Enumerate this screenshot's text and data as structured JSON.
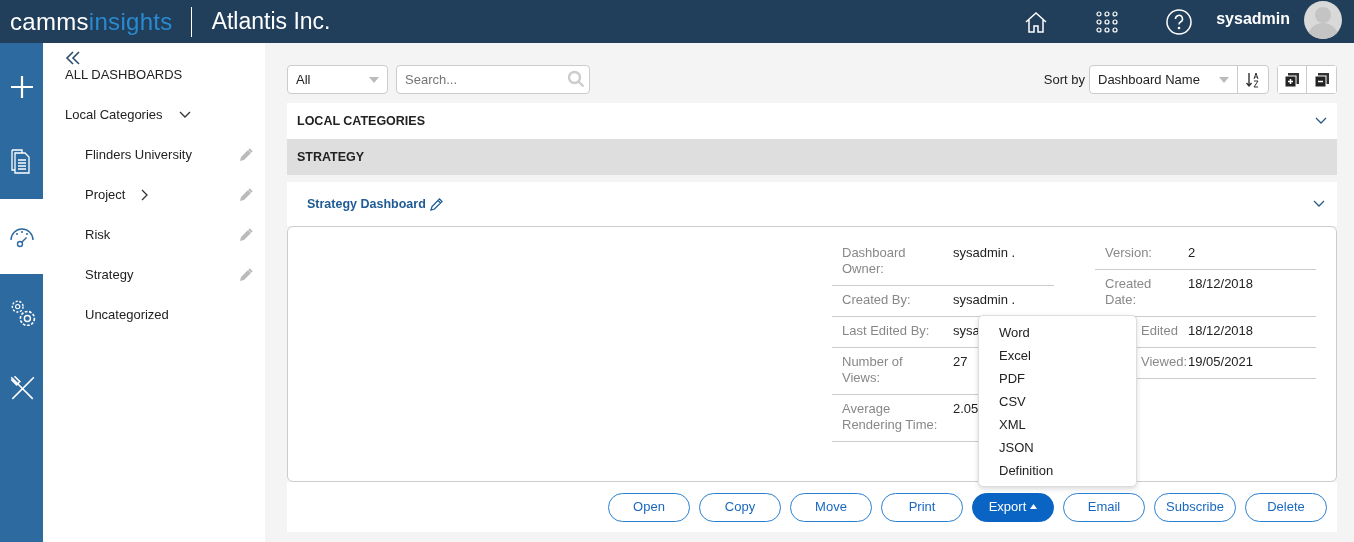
{
  "header": {
    "logo_left": "camms",
    "logo_right": "insights",
    "org": "Atlantis Inc.",
    "user": "sysadmin"
  },
  "rail": [
    {
      "selected": false
    },
    {
      "selected": false
    },
    {
      "selected": true
    },
    {
      "selected": false
    },
    {
      "selected": false
    }
  ],
  "sidebar": {
    "title": "ALL DASHBOARDS",
    "section": "Local Categories",
    "items": [
      {
        "label": "Flinders University",
        "has_children": false,
        "editable": true
      },
      {
        "label": "Project",
        "has_children": true,
        "editable": true
      },
      {
        "label": "Risk",
        "has_children": false,
        "editable": true
      },
      {
        "label": "Strategy",
        "has_children": false,
        "editable": true
      },
      {
        "label": "Uncategorized",
        "has_children": false,
        "editable": false
      }
    ]
  },
  "toolbar": {
    "filter": "All",
    "search_placeholder": "Search...",
    "sort_label": "Sort by",
    "sort_value": "Dashboard Name"
  },
  "sections": [
    {
      "title": "LOCAL CATEGORIES",
      "selected": false
    },
    {
      "title": "STRATEGY",
      "selected": true
    }
  ],
  "dashboard": {
    "name": "Strategy Dashboard",
    "details_left": [
      {
        "label": "Dashboard Owner:",
        "value": "sysadmin ."
      },
      {
        "label": "Created By:",
        "value": "sysadmin ."
      },
      {
        "label": "Last Edited By:",
        "value": "sysa"
      },
      {
        "label": "Number of Views:",
        "value": "27"
      },
      {
        "label": "Average Rendering Time:",
        "value": "2.05"
      }
    ],
    "details_right": [
      {
        "label": "Version:",
        "value": "2",
        "covered": false
      },
      {
        "label": "Created Date:",
        "value": "18/12/2018",
        "covered": false
      },
      {
        "label": "Edited",
        "value": "18/12/2018",
        "covered": true
      },
      {
        "label": "Viewed:",
        "value": "19/05/2021",
        "covered": true
      }
    ],
    "actions": [
      {
        "label": "Open",
        "selected": false,
        "dropdown": false
      },
      {
        "label": "Copy",
        "selected": false,
        "dropdown": false
      },
      {
        "label": "Move",
        "selected": false,
        "dropdown": false
      },
      {
        "label": "Print",
        "selected": false,
        "dropdown": false
      },
      {
        "label": "Export",
        "selected": true,
        "dropdown": true
      },
      {
        "label": "Email",
        "selected": false,
        "dropdown": false
      },
      {
        "label": "Subscribe",
        "selected": false,
        "dropdown": false
      },
      {
        "label": "Delete",
        "selected": false,
        "dropdown": false
      }
    ],
    "export_menu": [
      "Word",
      "Excel",
      "PDF",
      "CSV",
      "XML",
      "JSON",
      "Definition"
    ]
  }
}
